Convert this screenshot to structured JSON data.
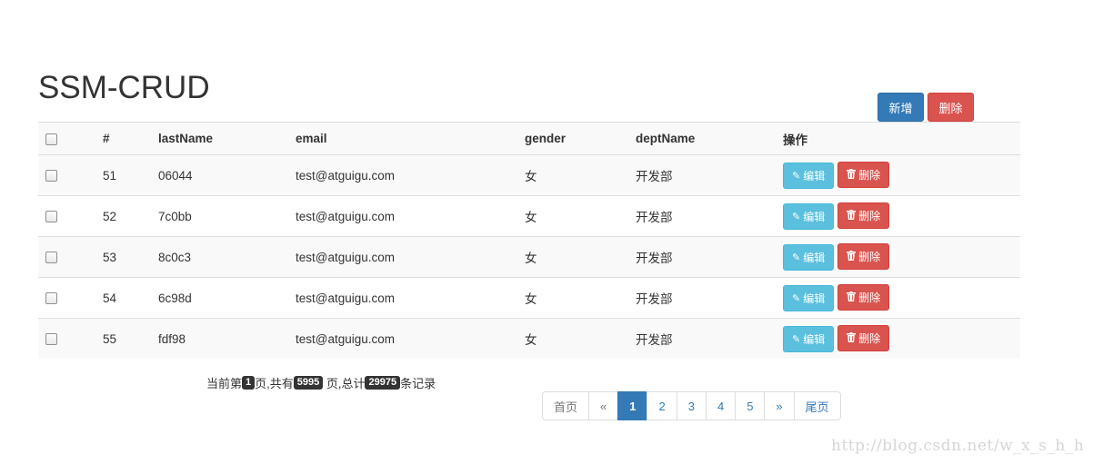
{
  "page": {
    "title": "SSM-CRUD"
  },
  "toolbar": {
    "add_label": "新增",
    "delete_label": "删除"
  },
  "table": {
    "headers": [
      "#",
      "lastName",
      "email",
      "gender",
      "deptName",
      "操作"
    ],
    "edit_label": "编辑",
    "delete_label": "删除",
    "rows": [
      {
        "id": "51",
        "lastName": "06044",
        "email": "test@atguigu.com",
        "gender": "女",
        "deptName": "开发部"
      },
      {
        "id": "52",
        "lastName": "7c0bb",
        "email": "test@atguigu.com",
        "gender": "女",
        "deptName": "开发部"
      },
      {
        "id": "53",
        "lastName": "8c0c3",
        "email": "test@atguigu.com",
        "gender": "女",
        "deptName": "开发部"
      },
      {
        "id": "54",
        "lastName": "6c98d",
        "email": "test@atguigu.com",
        "gender": "女",
        "deptName": "开发部"
      },
      {
        "id": "55",
        "lastName": "fdf98",
        "email": "test@atguigu.com",
        "gender": "女",
        "deptName": "开发部"
      }
    ]
  },
  "pageinfo": {
    "prefix": "当前第",
    "current": "1",
    "mid1": "页,共有",
    "total_pages": "5995",
    "mid2": " 页,总计",
    "total_records": "29975",
    "suffix": "条记录"
  },
  "pagination": {
    "first": "首页",
    "prev": "«",
    "pages": [
      "1",
      "2",
      "3",
      "4",
      "5"
    ],
    "active": "1",
    "next": "»",
    "last": "尾页"
  },
  "watermark": "http://blog.csdn.net/w_x_s_h_h",
  "colors": {
    "primary": "#337ab7",
    "danger": "#d9534f",
    "info": "#5bc0de"
  },
  "icons": {
    "edit": "pencil-icon",
    "delete": "trash-icon"
  }
}
